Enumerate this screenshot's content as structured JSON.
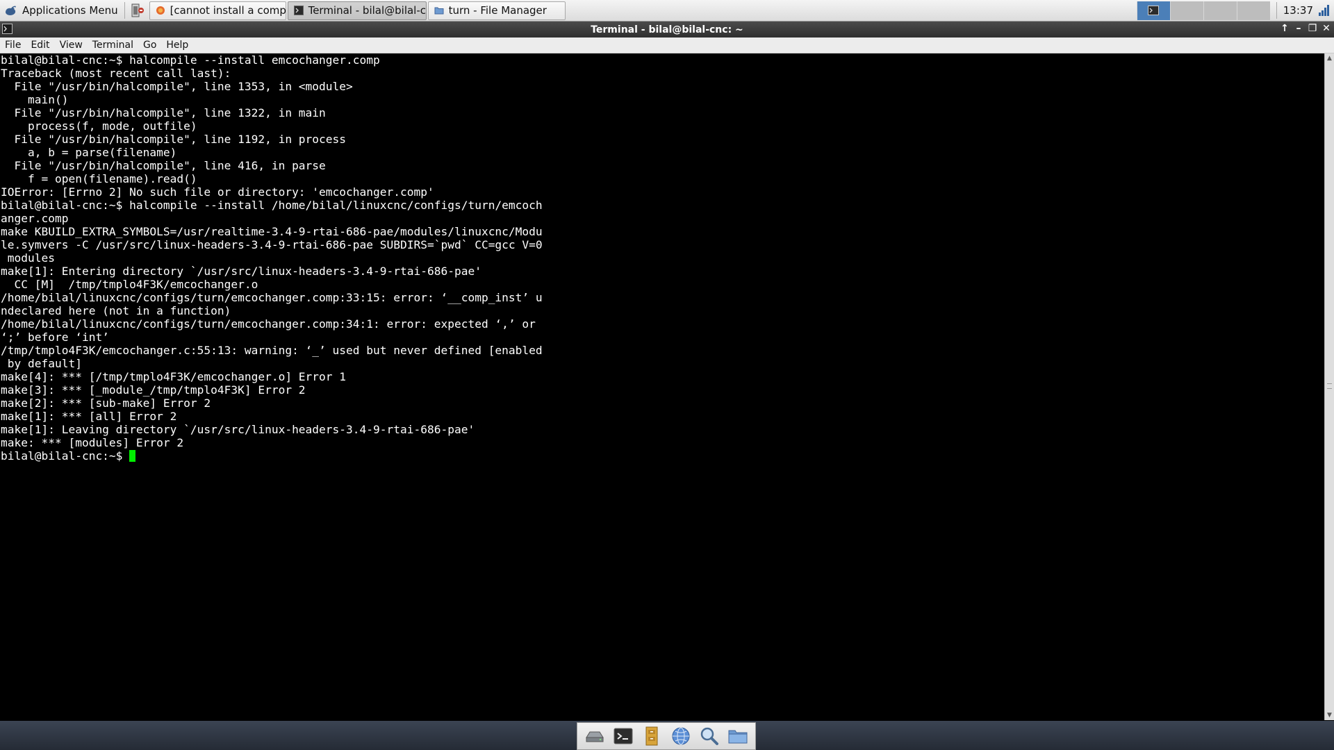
{
  "panel": {
    "apps_menu_label": "Applications Menu",
    "tasks": [
      {
        "label": "[cannot install a comp n...",
        "icon": "firefox-icon"
      },
      {
        "label": "Terminal - bilal@bilal-cn...",
        "icon": "terminal-icon"
      },
      {
        "label": "turn - File Manager",
        "icon": "folder-icon"
      }
    ],
    "clock": "13:37"
  },
  "window": {
    "title": "Terminal - bilal@bilal-cnc: ~"
  },
  "menu": {
    "file": "File",
    "edit": "Edit",
    "view": "View",
    "terminal": "Terminal",
    "go": "Go",
    "help": "Help"
  },
  "terminal": {
    "lines": [
      "bilal@bilal-cnc:~$ halcompile --install emcochanger.comp",
      "Traceback (most recent call last):",
      "  File \"/usr/bin/halcompile\", line 1353, in <module>",
      "    main()",
      "  File \"/usr/bin/halcompile\", line 1322, in main",
      "    process(f, mode, outfile)",
      "  File \"/usr/bin/halcompile\", line 1192, in process",
      "    a, b = parse(filename)",
      "  File \"/usr/bin/halcompile\", line 416, in parse",
      "    f = open(filename).read()",
      "IOError: [Errno 2] No such file or directory: 'emcochanger.comp'",
      "bilal@bilal-cnc:~$ halcompile --install /home/bilal/linuxcnc/configs/turn/emcoch",
      "anger.comp",
      "make KBUILD_EXTRA_SYMBOLS=/usr/realtime-3.4-9-rtai-686-pae/modules/linuxcnc/Modu",
      "le.symvers -C /usr/src/linux-headers-3.4-9-rtai-686-pae SUBDIRS=`pwd` CC=gcc V=0",
      " modules",
      "make[1]: Entering directory `/usr/src/linux-headers-3.4-9-rtai-686-pae'",
      "  CC [M]  /tmp/tmplo4F3K/emcochanger.o",
      "/home/bilal/linuxcnc/configs/turn/emcochanger.comp:33:15: error: ‘__comp_inst’ u",
      "ndeclared here (not in a function)",
      "/home/bilal/linuxcnc/configs/turn/emcochanger.comp:34:1: error: expected ‘,’ or",
      "‘;’ before ‘int’",
      "/tmp/tmplo4F3K/emcochanger.c:55:13: warning: ‘_’ used but never defined [enabled",
      " by default]",
      "make[4]: *** [/tmp/tmplo4F3K/emcochanger.o] Error 1",
      "make[3]: *** [_module_/tmp/tmplo4F3K] Error 2",
      "make[2]: *** [sub-make] Error 2",
      "make[1]: *** [all] Error 2",
      "make[1]: Leaving directory `/usr/src/linux-headers-3.4-9-rtai-686-pae'",
      "make: *** [modules] Error 2"
    ],
    "prompt": "bilal@bilal-cnc:~$ ",
    "cursor_color": "#00ee00"
  },
  "dock": {
    "items": [
      "drive-icon",
      "terminal-icon",
      "file-cabinet-icon",
      "web-browser-icon",
      "search-icon",
      "folder-icon"
    ]
  }
}
